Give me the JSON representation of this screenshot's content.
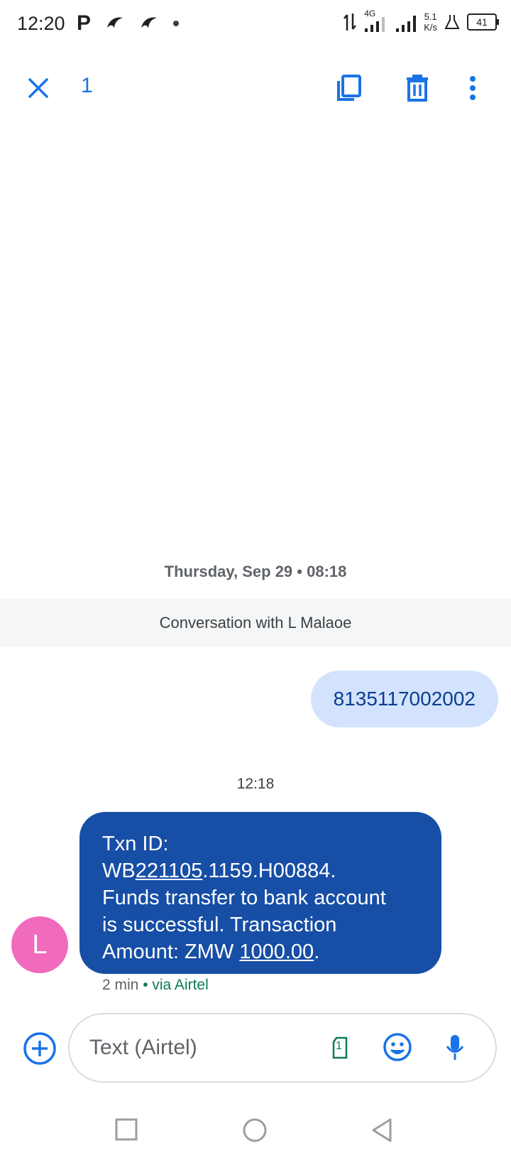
{
  "status_bar": {
    "time": "12:20",
    "left_icons": [
      "parking-icon",
      "bird-app-icon",
      "bird-app-icon",
      "dot-indicator"
    ],
    "network": "4G",
    "speed_value": "5.1",
    "speed_unit": "K/s",
    "battery": "41"
  },
  "action_bar": {
    "selected_count": "1",
    "icons": [
      "close-icon",
      "copy-icon",
      "delete-icon",
      "more-vert-icon"
    ]
  },
  "conversation": {
    "date_header": "Thursday, Sep 29 • 08:18",
    "banner": "Conversation with L Malaoe",
    "outgoing_message": "8135117002002",
    "time_label": "12:18",
    "incoming": {
      "avatar_letter": "L",
      "line1": "Txn ID:",
      "line2_prefix": "WB",
      "line2_link": "221105",
      "line2_suffix": ".1159.H00884.",
      "line3": "Funds transfer to bank account",
      "line4": "is successful. Transaction",
      "line5_prefix": "Amount: ZMW ",
      "line5_link": "1000.00",
      "line5_suffix": ".",
      "meta_time": "2 min",
      "meta_sep": " • ",
      "meta_via": "via Airtel"
    }
  },
  "composer": {
    "placeholder": "Text (Airtel)",
    "sim_label": "1"
  },
  "colors": {
    "accent": "#1a73e8",
    "incoming_bubble": "#174ea6",
    "outgoing_bubble": "#d3e3fd",
    "avatar": "#f06bbd"
  }
}
